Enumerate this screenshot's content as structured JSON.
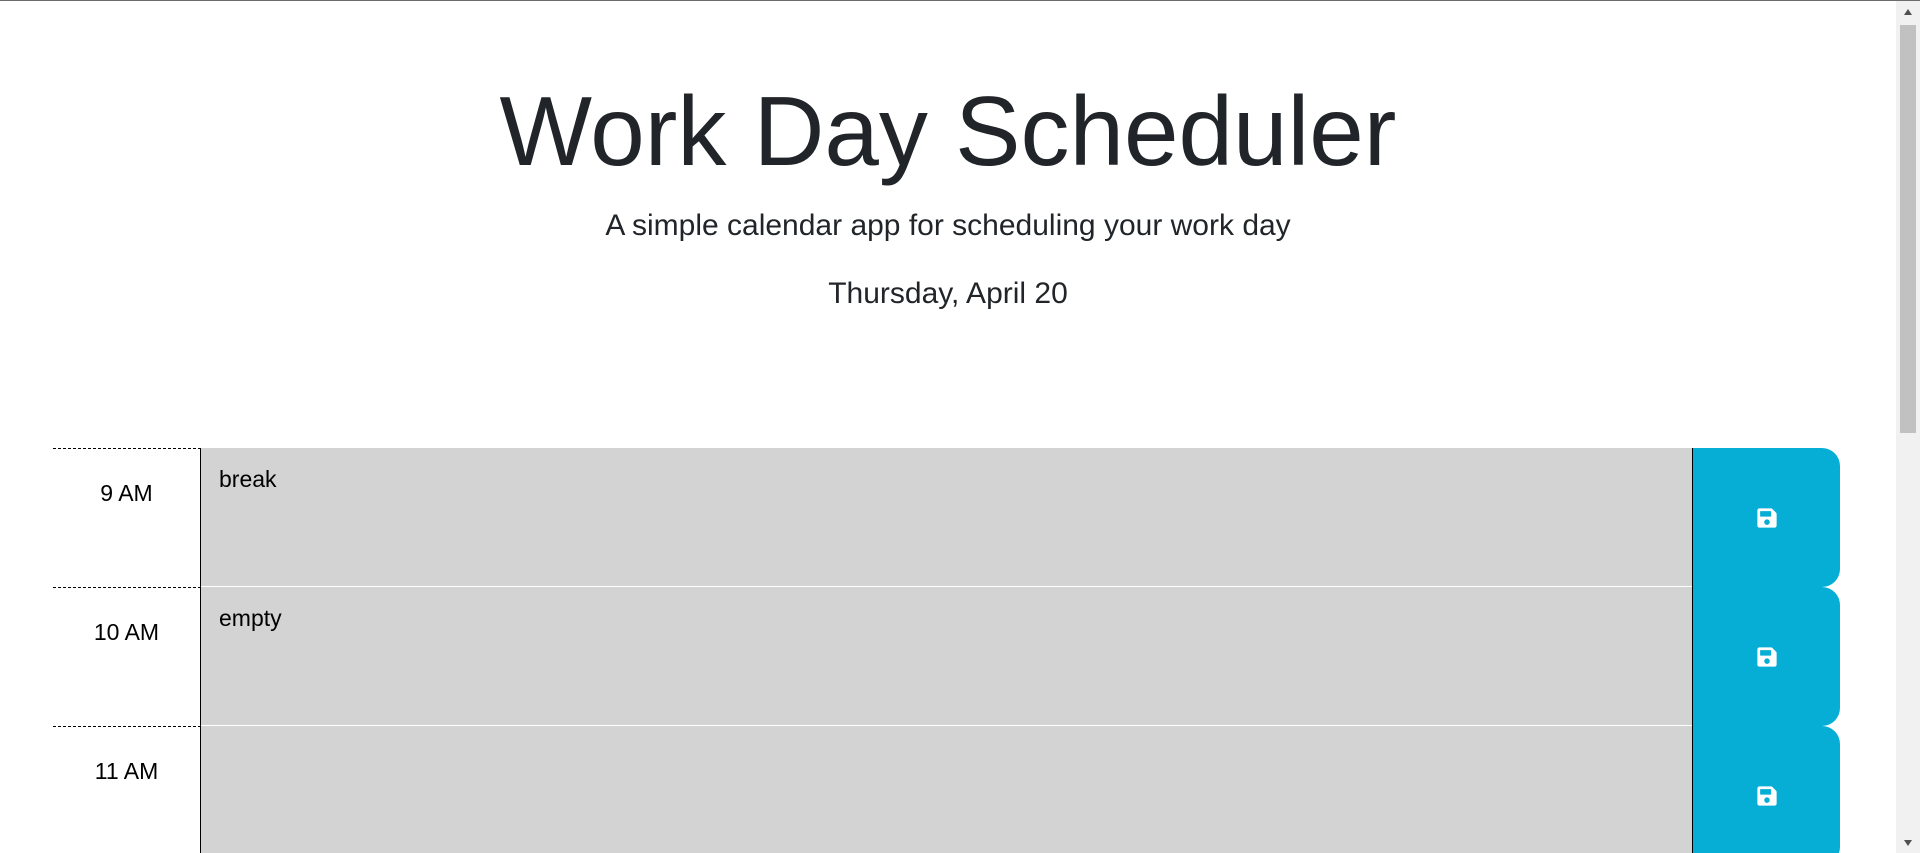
{
  "header": {
    "title": "Work Day Scheduler",
    "subtitle": "A simple calendar app for scheduling your work day",
    "current_day": "Thursday, April 20"
  },
  "timeblocks": [
    {
      "hour": "9 AM",
      "text": "break",
      "save_icon": "floppy-disk-icon"
    },
    {
      "hour": "10 AM",
      "text": "empty",
      "save_icon": "floppy-disk-icon"
    },
    {
      "hour": "11 AM",
      "text": "",
      "save_icon": "floppy-disk-icon"
    }
  ],
  "colors": {
    "past_block": "#d3d3d3",
    "save_button": "#06aed5",
    "text": "#212529"
  }
}
